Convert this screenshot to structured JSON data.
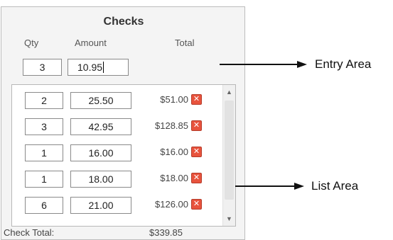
{
  "panel": {
    "title": "Checks",
    "headers": {
      "qty": "Qty",
      "amount": "Amount",
      "total": "Total"
    },
    "entry": {
      "qty": "3",
      "amount": "10.95"
    },
    "rows": [
      {
        "qty": "2",
        "amount": "25.50",
        "total": "$51.00"
      },
      {
        "qty": "3",
        "amount": "42.95",
        "total": "$128.85"
      },
      {
        "qty": "1",
        "amount": "16.00",
        "total": "$16.00"
      },
      {
        "qty": "1",
        "amount": "18.00",
        "total": "$18.00"
      },
      {
        "qty": "6",
        "amount": "21.00",
        "total": "$126.00"
      }
    ],
    "footer": {
      "label": "Check Total:",
      "value": "$339.85"
    },
    "delete_icon": "close-x-icon",
    "delete_color": "#e8533d"
  },
  "annotations": {
    "entry_area": "Entry Area",
    "list_area": "List Area"
  },
  "scrollbar": {
    "up_glyph": "▲",
    "down_glyph": "▼"
  }
}
